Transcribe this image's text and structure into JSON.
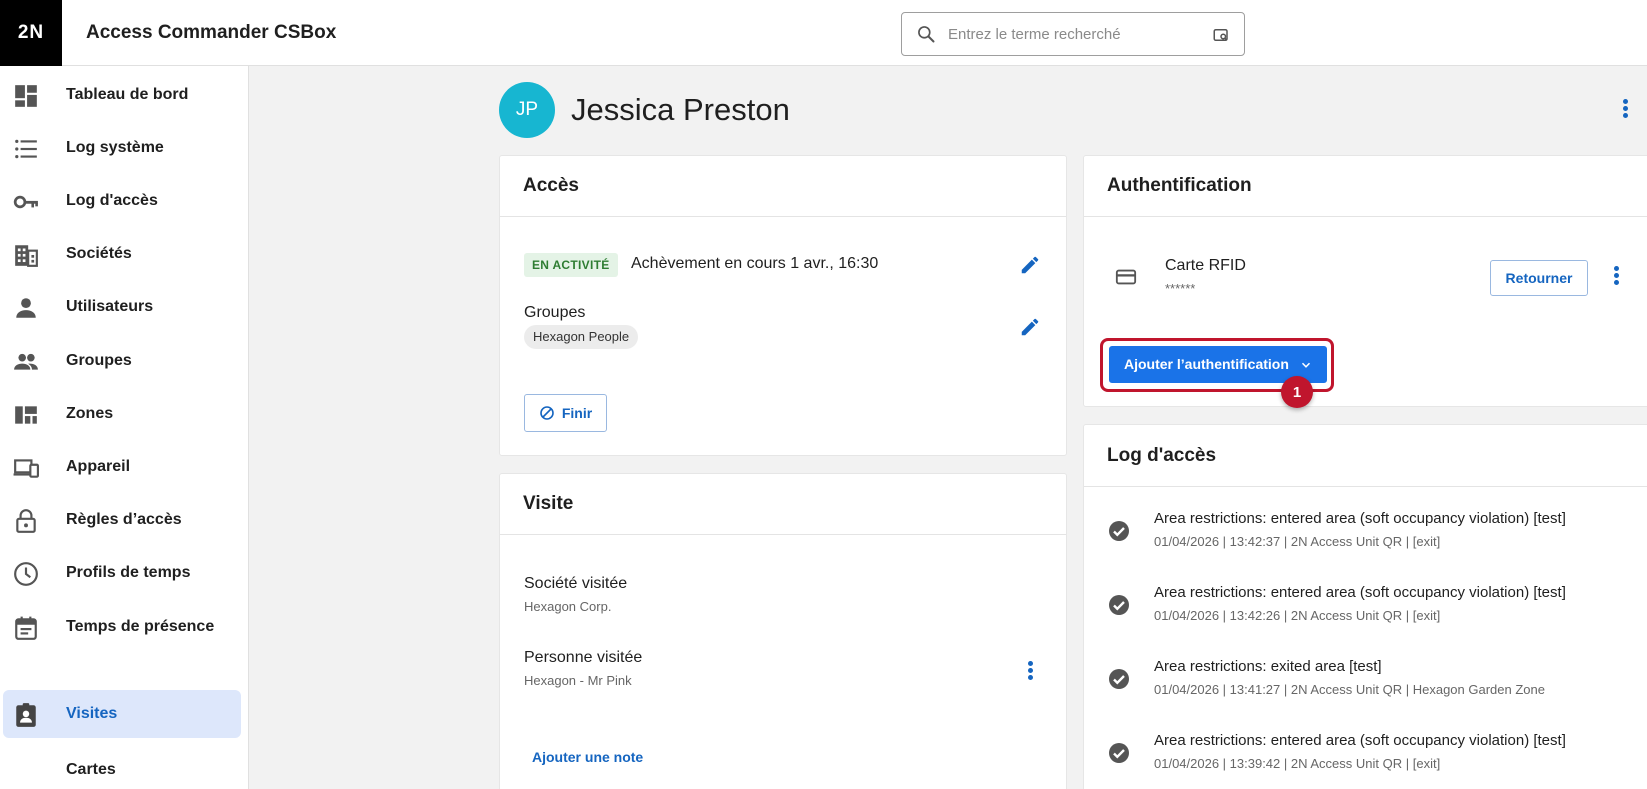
{
  "header": {
    "logo_text": "2N",
    "app_title": "Access Commander CSBox",
    "search_placeholder": "Entrez le terme recherché"
  },
  "sidebar": {
    "items": [
      {
        "label": "Tableau de bord",
        "icon": "dashboard-icon"
      },
      {
        "label": "Log système",
        "icon": "list-icon"
      },
      {
        "label": "Log d'accès",
        "icon": "key-icon"
      },
      {
        "label": "Sociétés",
        "icon": "building-icon"
      },
      {
        "label": "Utilisateurs",
        "icon": "person-icon"
      },
      {
        "label": "Groupes",
        "icon": "group-icon"
      },
      {
        "label": "Zones",
        "icon": "zones-icon"
      },
      {
        "label": "Appareil",
        "icon": "devices-icon"
      },
      {
        "label": "Règles d’accès",
        "icon": "lock-icon"
      },
      {
        "label": "Profils de temps",
        "icon": "clock-icon"
      },
      {
        "label": "Temps de présence",
        "icon": "calendar-icon"
      },
      {
        "label": "Visites",
        "icon": "visitor-badge-icon",
        "active": true
      },
      {
        "label": "Cartes",
        "icon": ""
      }
    ]
  },
  "person": {
    "initials": "JP",
    "name": "Jessica Preston"
  },
  "access_card": {
    "title": "Accès",
    "status_badge": "EN ACTIVITÉ",
    "status_text": "Achèvement en cours 1 avr., 16:30",
    "groups_label": "Groupes",
    "group_chip": "Hexagon People",
    "finish_button": "Finir"
  },
  "visit_card": {
    "title": "Visite",
    "company_label": "Société visitée",
    "company_value": "Hexagon Corp.",
    "person_label": "Personne visitée",
    "person_value": "Hexagon - Mr Pink",
    "add_note": "Ajouter une note"
  },
  "auth_card": {
    "title": "Authentification",
    "credential_type": "Carte RFID",
    "credential_value": "******",
    "return_button": "Retourner",
    "add_button": "Ajouter l’authentification",
    "step_number": "1"
  },
  "access_log": {
    "title": "Log d'accès",
    "entries": [
      {
        "title": "Area restrictions: entered area (soft occupancy violation) [test]",
        "meta": "01/04/2026 | 13:42:37 | 2N Access Unit QR | [exit]"
      },
      {
        "title": "Area restrictions: entered area (soft occupancy violation) [test]",
        "meta": "01/04/2026 | 13:42:26 | 2N Access Unit QR | [exit]"
      },
      {
        "title": "Area restrictions: exited area [test]",
        "meta": "01/04/2026 | 13:41:27 | 2N Access Unit QR | Hexagon Garden Zone"
      },
      {
        "title": "Area restrictions: entered area (soft occupancy violation) [test]",
        "meta": "01/04/2026 | 13:39:42 | 2N Access Unit QR | [exit]"
      }
    ]
  },
  "colors": {
    "accent": "#1a73e8",
    "highlight": "#c0152d",
    "active_nav_bg": "#dde7fb",
    "avatar": "#17b6d1"
  }
}
